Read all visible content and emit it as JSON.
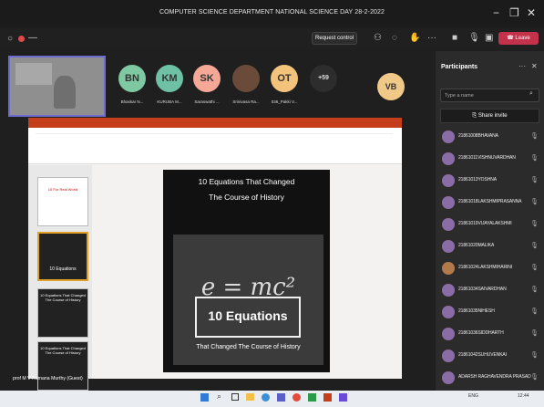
{
  "window": {
    "title": "COMPUTER SCIENCE DEPARTMENT NATIONAL SCIENCE DAY 28-2-2022",
    "minimize": "−",
    "restore": "❐",
    "close": "✕"
  },
  "toolbar": {
    "request_control": "Request control",
    "leave": "Leave",
    "more": "···"
  },
  "attendees": [
    {
      "initials": "BN",
      "name": "Bhaskar N...",
      "color": "#7fc9a2"
    },
    {
      "initials": "KM",
      "name": "KURUBA M...",
      "color": "#6fc1a6"
    },
    {
      "initials": "SK",
      "name": "Saraswathi ...",
      "color": "#f6a897"
    },
    {
      "initials": "",
      "name": "Srinivasa Ra...",
      "color": "#6a4b3a"
    },
    {
      "initials": "OT",
      "name": "036_Pakki V...",
      "color": "#f3c27b"
    },
    {
      "initials": "+59",
      "name": "",
      "color": "#2d2d2d"
    },
    {
      "initials": "VB",
      "name": "",
      "color": "#f0c989"
    }
  ],
  "presenter_name": "prof M V Ramana Murthy (Guest)",
  "slide": {
    "title_line1": "10 Equations That Changed",
    "title_line2": "The Course of History",
    "formula": "e = mc²",
    "box_text": "10 Equations",
    "box_sub": "That Changed The Course of History"
  },
  "thumbnails": [
    {
      "text": "10 For Real World"
    },
    {
      "text": "10 Equations"
    },
    {
      "text": "10 Equations That Changed The Course of History"
    },
    {
      "text": "10 Equations That Changed The Course of History"
    }
  ],
  "participants": {
    "title": "Participants",
    "search_placeholder": "Type a name",
    "share_invite": "Share invite",
    "list": [
      "21861008BHAVANA",
      "21861011VISHNUVARDHAN",
      "21861013YOSHNA",
      "21861018LAKSHMIPRASANNA",
      "21861019VIJAYALAKSHMI",
      "21861020MALIKA",
      "21861024LAKSHMIHARINI",
      "21861034SAIVARDHAN",
      "21861035NIHESH",
      "21861036SIDDHARTH",
      "21861042SUHUVENKAI",
      "ADARSH RAGHAVENDRA PRASAD"
    ]
  },
  "taskbar": {
    "lang": "ENG",
    "time": "12:44"
  }
}
